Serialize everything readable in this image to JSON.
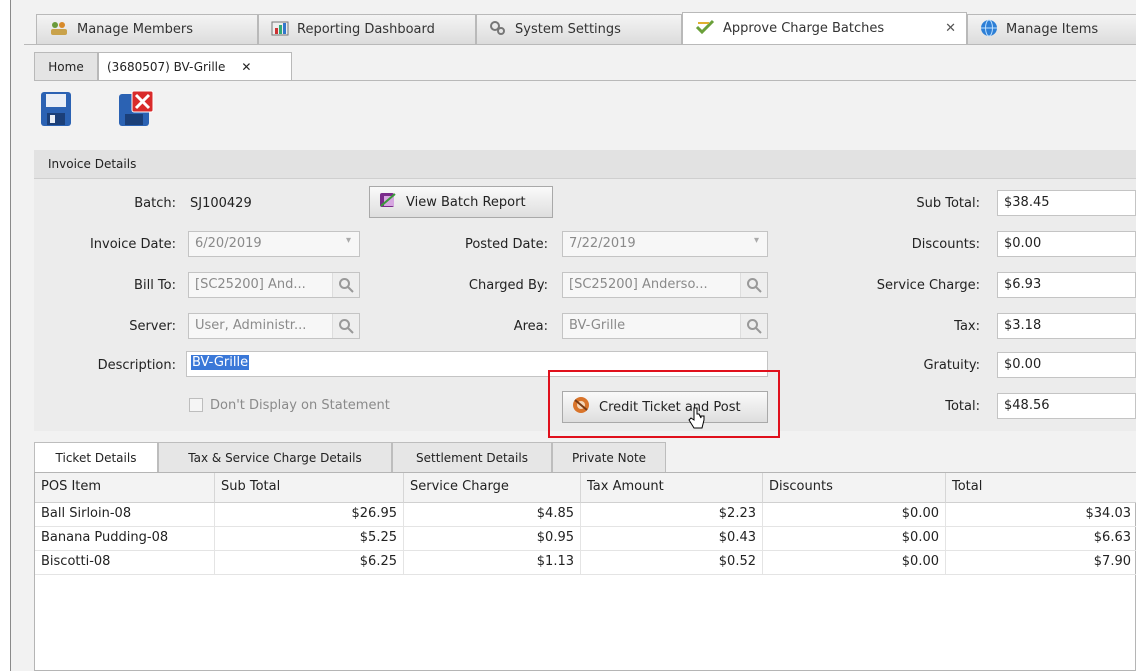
{
  "top_tabs": [
    {
      "label": "Manage Members",
      "icon": "members-icon"
    },
    {
      "label": "Reporting Dashboard",
      "icon": "chart-icon"
    },
    {
      "label": "System Settings",
      "icon": "gears-icon"
    },
    {
      "label": "Approve Charge Batches",
      "icon": "approve-check-icon",
      "active": true
    },
    {
      "label": "Manage Items",
      "icon": "globe-icon"
    }
  ],
  "sub_tabs": [
    {
      "label": "Home"
    },
    {
      "label": "(3680507) BV-Grille",
      "active": true
    }
  ],
  "close_glyph": "✕",
  "invoice": {
    "section_title": "Invoice Details",
    "batch_label": "Batch:",
    "batch_value": "SJ100429",
    "view_batch_report": "View Batch Report",
    "invoice_date_label": "Invoice Date:",
    "invoice_date_value": "6/20/2019",
    "posted_date_label": "Posted Date:",
    "posted_date_value": "7/22/2019",
    "bill_to_label": "Bill To:",
    "bill_to_value": "[SC25200] And...",
    "charged_by_label": "Charged By:",
    "charged_by_value": "[SC25200] Anderso...",
    "server_label": "Server:",
    "server_value": "User, Administr...",
    "area_label": "Area:",
    "area_value": "BV-Grille",
    "description_label": "Description:",
    "description_value": "BV-Grille",
    "dont_display_label": "Don't Display on Statement",
    "credit_post_button": "Credit Ticket and Post"
  },
  "totals": {
    "sub_total_label": "Sub Total:",
    "sub_total": "$38.45",
    "discounts_label": "Discounts:",
    "discounts": "$0.00",
    "service_charge_label": "Service Charge:",
    "service_charge": "$6.93",
    "tax_label": "Tax:",
    "tax": "$3.18",
    "gratuity_label": "Gratuity:",
    "gratuity": "$0.00",
    "total_label": "Total:",
    "total": "$48.56"
  },
  "detail_tabs": [
    {
      "label": "Ticket Details",
      "active": true
    },
    {
      "label": "Tax & Service Charge Details"
    },
    {
      "label": "Settlement Details"
    },
    {
      "label": "Private Note"
    }
  ],
  "grid": {
    "columns": [
      "POS Item",
      "Sub Total",
      "Service Charge",
      "Tax Amount",
      "Discounts",
      "Total"
    ],
    "rows": [
      [
        "Ball Sirloin-08",
        "$26.95",
        "$4.85",
        "$2.23",
        "$0.00",
        "$34.03"
      ],
      [
        "Banana Pudding-08",
        "$5.25",
        "$0.95",
        "$0.43",
        "$0.00",
        "$6.63"
      ],
      [
        "Biscotti-08",
        "$6.25",
        "$1.13",
        "$0.52",
        "$0.00",
        "$7.90"
      ]
    ]
  },
  "colors": {
    "highlight_box": "#e0101c",
    "selection": "#3a78d8"
  }
}
